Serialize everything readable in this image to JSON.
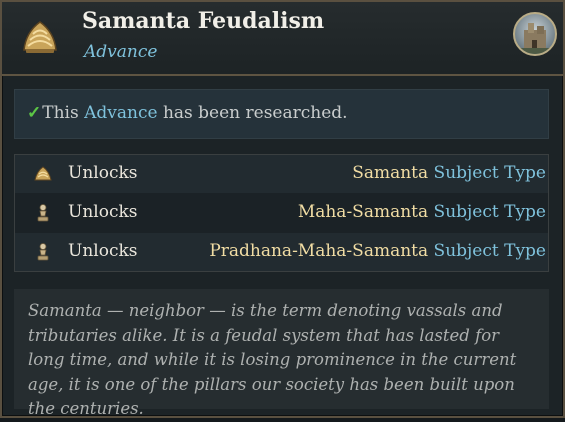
{
  "header": {
    "title": "Samanta Feudalism",
    "subtitle": "Advance",
    "advance_icon": "scale-armor-icon",
    "portrait_icon": "fortress-portrait-icon"
  },
  "researched": {
    "check_icon": "✓",
    "prefix": "This ",
    "highlight": "Advance",
    "suffix": " has been researched."
  },
  "unlocks": [
    {
      "icon": "scale-armor-icon",
      "label": "Unlocks",
      "name": "Samanta",
      "type": "Subject Type"
    },
    {
      "icon": "pawn-icon",
      "label": "Unlocks",
      "name": "Maha-Samanta",
      "type": "Subject Type"
    },
    {
      "icon": "pawn-icon",
      "label": "Unlocks",
      "name": "Pradhana-Maha-Samanta",
      "type": "Subject Type"
    }
  ],
  "description": "Samanta — neighbor — is the term denoting vassals and tributaries alike. It is a feudal system that has lasted for long time, and while it is losing prominence in the current age, it is one of the pillars our society has been built upon the centuries.",
  "colors": {
    "highlight_blue": "#7fc2dc",
    "name_gold": "#f1dda4",
    "check_green": "#5cc646",
    "frame": "#5a5040"
  }
}
